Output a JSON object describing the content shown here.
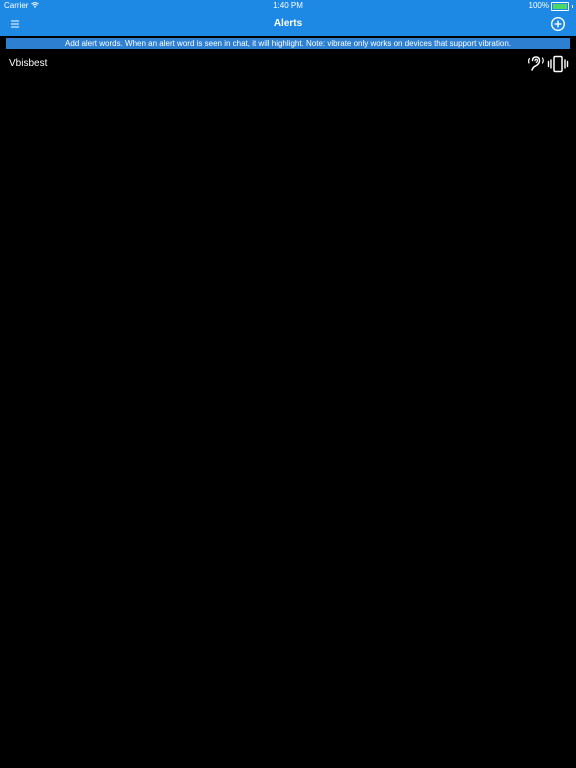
{
  "status_bar": {
    "carrier": "Carrier",
    "time": "1:40 PM",
    "battery_percent": "100%",
    "battery_level": 1.0
  },
  "nav": {
    "title": "Alerts",
    "menu_icon": "hamburger-menu-icon",
    "add_icon": "add-circle-icon"
  },
  "banner": {
    "text": "Add alert words.  When an alert word is seen in chat, it will highlight.  Note: vibrate only works on devices that support vibration."
  },
  "alerts": [
    {
      "word": "Vbisbest",
      "sound_icon": "hearing-icon",
      "vibrate_icon": "vibrate-icon"
    }
  ],
  "colors": {
    "header": "#1e88e5",
    "banner": "#2c7fd1",
    "background": "#000000",
    "battery": "#4cd964"
  }
}
